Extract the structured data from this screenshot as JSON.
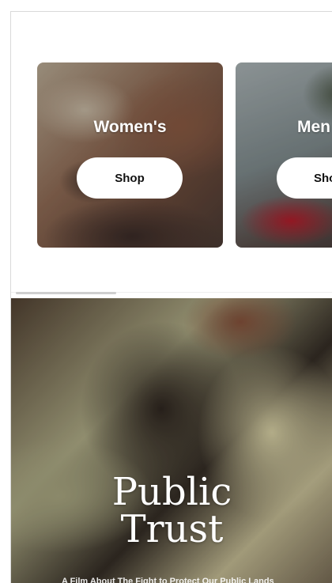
{
  "categories": [
    {
      "title": "Women's",
      "button_label": "Shop"
    },
    {
      "title": "Men",
      "button_label": "Sho"
    }
  ],
  "hero": {
    "title_line1": "Public",
    "title_line2": "Trust",
    "subtitle": "A Film About The Fight to Protect Our Public Lands"
  },
  "colors": {
    "button_bg": "#ffffff",
    "button_text": "#111111",
    "overlay_text": "#ffffff"
  }
}
